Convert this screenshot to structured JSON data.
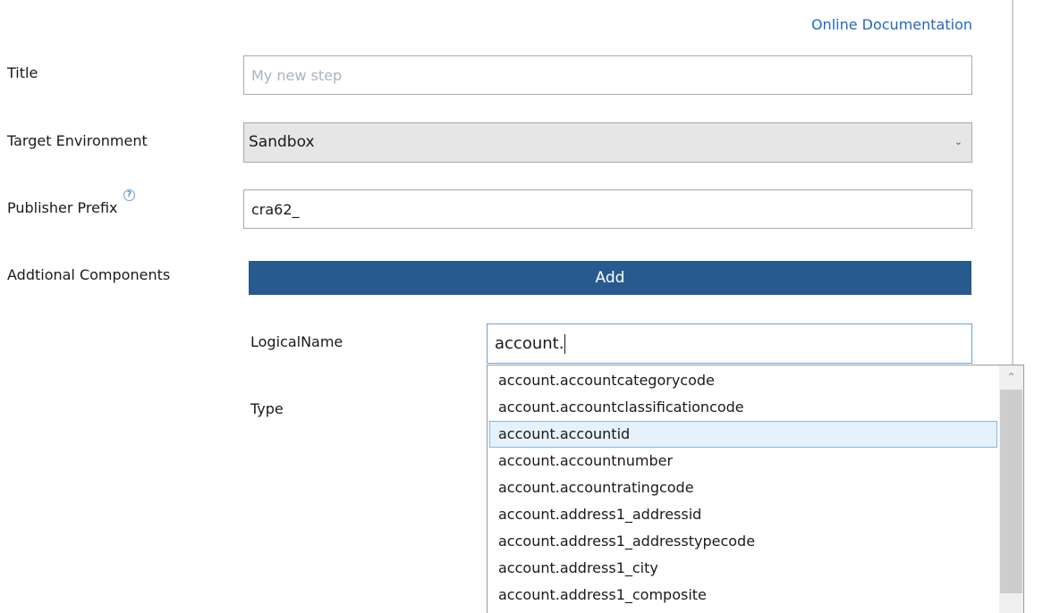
{
  "header": {
    "doc_link": "Online Documentation"
  },
  "form": {
    "title": {
      "label": "Title",
      "value": "",
      "placeholder": "My new step"
    },
    "target_environment": {
      "label": "Target Environment",
      "selected": "Sandbox"
    },
    "publisher_prefix": {
      "label": "Publisher Prefix",
      "value": "cra62_",
      "help_icon": "question-circle"
    },
    "additional_components": {
      "label": "Addtional Components",
      "add_label": "Add"
    },
    "logical_name": {
      "label": "LogicalName",
      "value": "account."
    },
    "type": {
      "label": "Type"
    }
  },
  "autocomplete": {
    "items": [
      "account.accountcategorycode",
      "account.accountclassificationcode",
      "account.accountid",
      "account.accountnumber",
      "account.accountratingcode",
      "account.address1_addressid",
      "account.address1_addresstypecode",
      "account.address1_city",
      "account.address1_composite"
    ],
    "selected_index": 2
  },
  "colors": {
    "accent": "#275a8f",
    "link": "#1f67c4",
    "selection": "#e5f1fb"
  }
}
